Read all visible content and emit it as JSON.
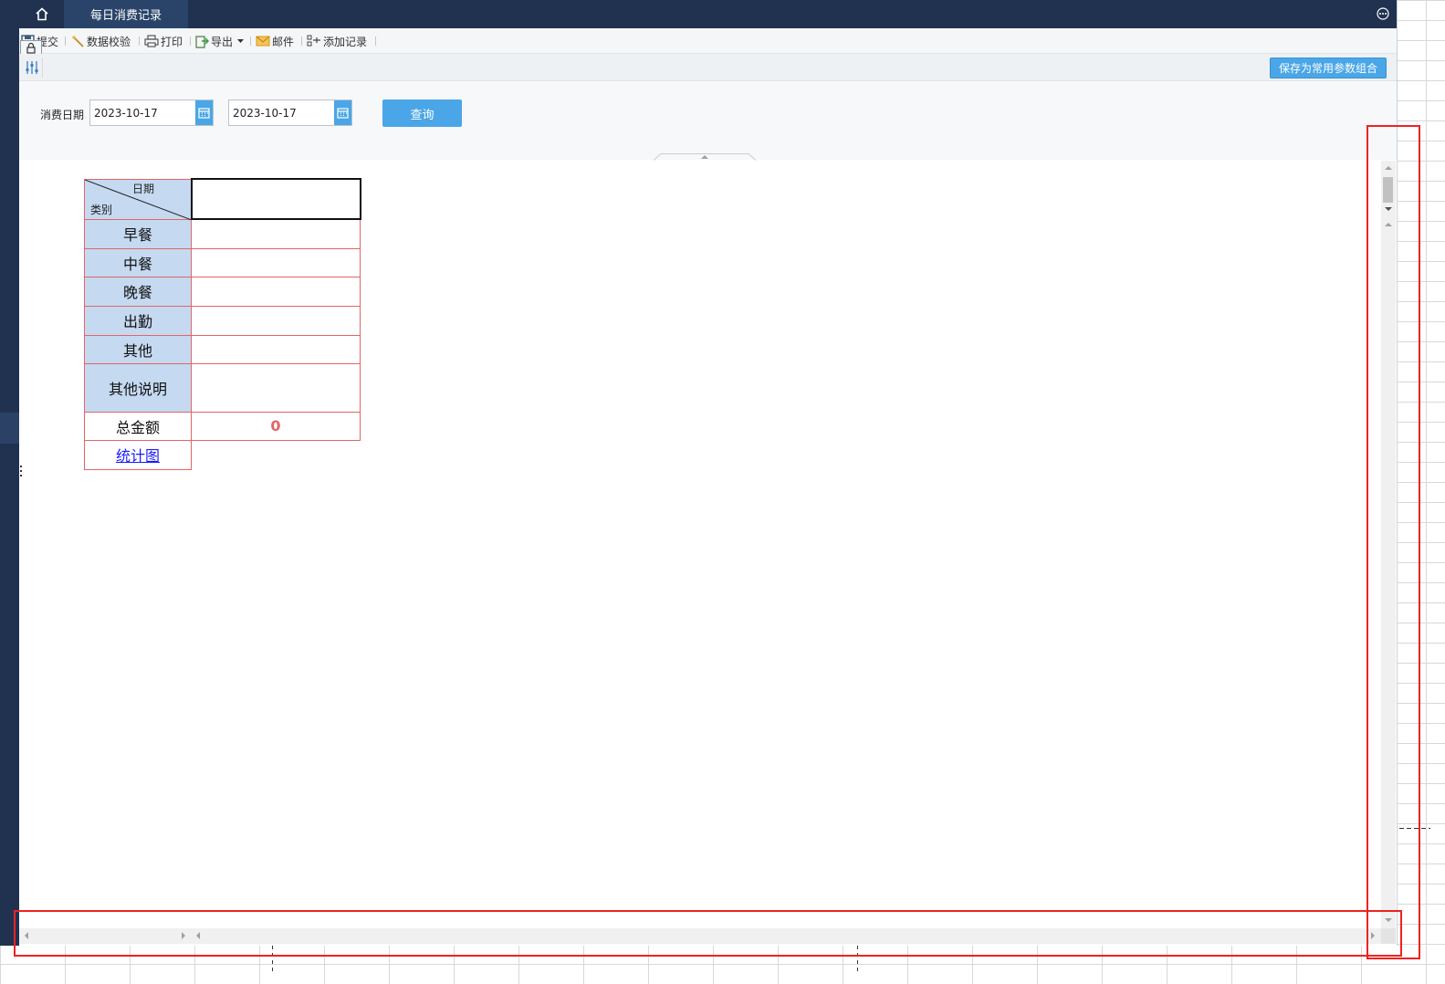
{
  "titlebar": {
    "active_tab": "每日消费记录"
  },
  "toolbar": {
    "submit": "提交",
    "validate": "数据校验",
    "print": "打印",
    "export": "导出",
    "mail": "邮件",
    "add_record": "添加记录"
  },
  "params": {
    "save_combo": "保存为常用参数组合",
    "date_label": "消费日期",
    "start_date": "2023-10-17",
    "end_date": "2023-10-17",
    "query": "查询"
  },
  "report": {
    "header_date": "日期",
    "header_category": "类别",
    "rows": [
      "早餐",
      "中餐",
      "晚餐",
      "出勤",
      "其他",
      "其他说明"
    ],
    "total_label": "总金额",
    "total_value": "0",
    "chart_link": "统计图"
  },
  "colors": {
    "titlebar": "#20324f",
    "accent": "#4aa6e6",
    "label_fill": "#c5d9f1",
    "border_red": "#e06666",
    "annotation": "#ee2222"
  }
}
